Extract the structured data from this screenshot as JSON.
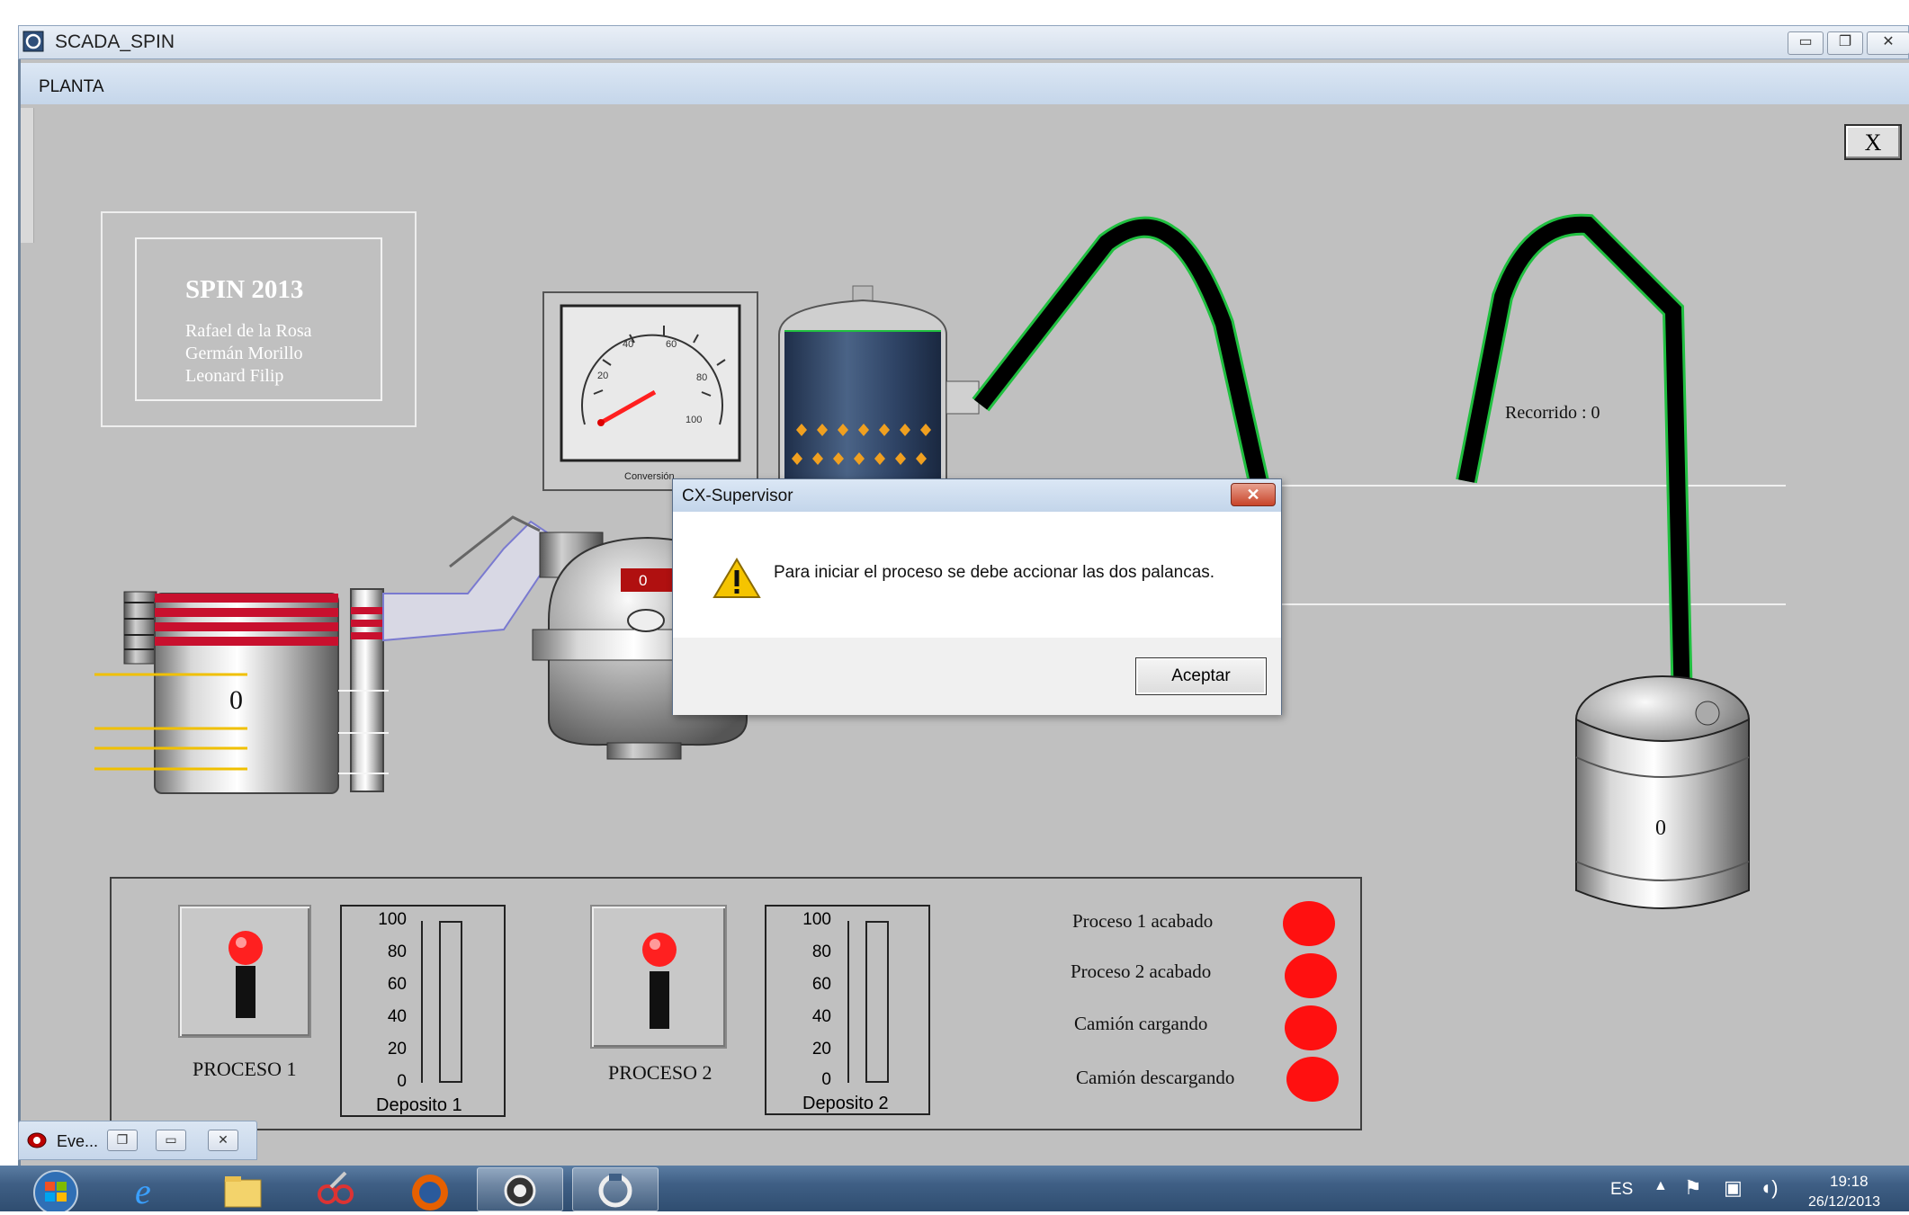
{
  "window": {
    "title": "SCADA_SPIN"
  },
  "tab": {
    "label": "PLANTA"
  },
  "close_button": {
    "label": "X"
  },
  "credits": {
    "title": "SPIN 2013",
    "names": [
      "Rafael de la Rosa",
      "Germán Morillo",
      "Leonard Filip"
    ]
  },
  "gauge": {
    "ticks": [
      "20",
      "40",
      "60",
      "80",
      "100"
    ],
    "label": "Conversión"
  },
  "reactor": {
    "display": "0"
  },
  "tank_left": {
    "value": "0"
  },
  "truck_tank": {
    "value": "0"
  },
  "recorrido": {
    "label": "Recorrido : 0"
  },
  "panel": {
    "proceso1": "PROCESO 1",
    "proceso2": "PROCESO 2",
    "deposito1": {
      "label": "Deposito 1",
      "ticks": [
        "100",
        "80",
        "60",
        "40",
        "20",
        "0"
      ],
      "level": 0
    },
    "deposito2": {
      "label": "Deposito 2",
      "ticks": [
        "100",
        "80",
        "60",
        "40",
        "20",
        "0"
      ],
      "level": 0
    },
    "status": [
      {
        "label": "Proceso 1 acabado",
        "color": "#ff1010"
      },
      {
        "label": "Proceso 2  acabado",
        "color": "#ff1010"
      },
      {
        "label": "Camión cargando",
        "color": "#ff1010"
      },
      {
        "label": "Camión descargando",
        "color": "#ff1010"
      }
    ]
  },
  "dialog": {
    "title": "CX-Supervisor",
    "close_icon": "close-icon",
    "message": "Para iniciar el proceso se debe accionar las dos palancas.",
    "ok_label": "Aceptar",
    "icon": "warning-icon"
  },
  "minimized": {
    "label": "Eve..."
  },
  "taskbar": {
    "items": [
      "start-orb-icon",
      "internet-explorer-icon",
      "file-explorer-icon",
      "snipping-tool-icon",
      "firefox-icon",
      "cx-supervisor-icon",
      "scada-icon"
    ],
    "lang": "ES",
    "time": "19:18",
    "date": "26/12/2013"
  }
}
